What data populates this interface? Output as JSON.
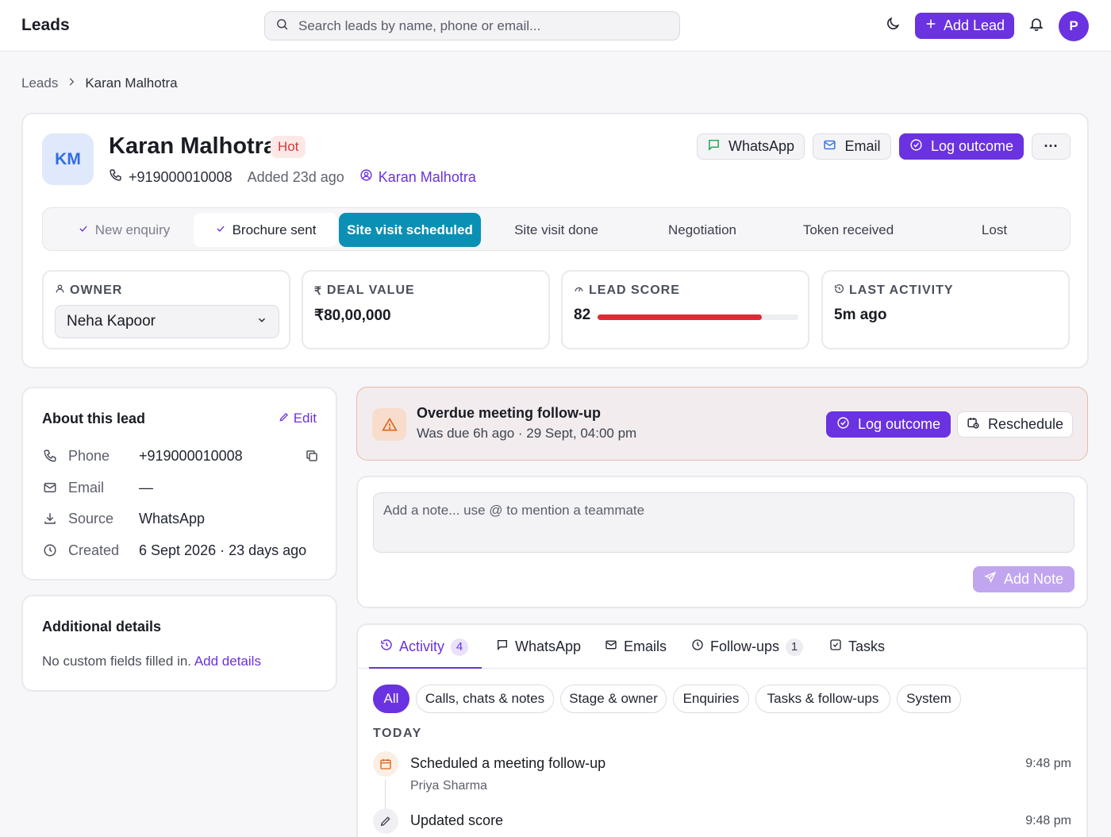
{
  "header": {
    "app_title": "Leads",
    "search_placeholder": "Search leads by name, phone or email...",
    "add_lead_label": "Add Lead",
    "user_initial": "P",
    "icons": [
      "moon-icon",
      "plus-icon",
      "bell-icon"
    ]
  },
  "breadcrumb": {
    "root": "Leads",
    "current": "Karan Malhotra"
  },
  "lead": {
    "initials": "KM",
    "name": "Karan Malhotra",
    "temperature": "Hot",
    "phone": "+919000010008",
    "added": "Added 23d ago",
    "assignee": "Karan Malhotra",
    "actions": {
      "whatsapp": "WhatsApp",
      "email": "Email",
      "log_outcome": "Log outcome",
      "more": "···"
    }
  },
  "stages": [
    {
      "label": "New enquiry",
      "state": "done"
    },
    {
      "label": "Brochure sent",
      "state": "prev"
    },
    {
      "label": "Site visit scheduled",
      "state": "current"
    },
    {
      "label": "Site visit done",
      "state": "future"
    },
    {
      "label": "Negotiation",
      "state": "future"
    },
    {
      "label": "Token received",
      "state": "future"
    },
    {
      "label": "Lost",
      "state": "future"
    }
  ],
  "stats": {
    "owner": {
      "label": "Owner",
      "value": "Neha Kapoor"
    },
    "deal_value": {
      "label": "Deal value",
      "value": "₹80,00,000"
    },
    "lead_score": {
      "label": "Lead score",
      "value": "82",
      "percent": 82,
      "bar_color": "#dc2b34"
    },
    "last_activity": {
      "label": "Last activity",
      "value": "5m ago"
    }
  },
  "about": {
    "title": "About this lead",
    "edit_label": "Edit",
    "rows": [
      {
        "label": "Phone",
        "value": "+919000010008",
        "icon": "phone-icon"
      },
      {
        "label": "Email",
        "value": "—",
        "icon": "mail-icon"
      },
      {
        "label": "Source",
        "value": "WhatsApp",
        "icon": "download-icon"
      },
      {
        "label": "Created",
        "value": "6 Sept 2026 · 23 days ago",
        "icon": "clock-icon"
      }
    ]
  },
  "additional": {
    "title": "Additional details",
    "empty_text": "No custom fields filled in.",
    "add_link": "Add details"
  },
  "overdue": {
    "title": "Overdue meeting follow-up",
    "subtitle": "Was due 6h ago · 29 Sept, 04:00 pm",
    "log_outcome": "Log outcome",
    "reschedule": "Reschedule"
  },
  "note": {
    "placeholder": "Add a note... use @ to mention a teammate",
    "add_label": "Add Note"
  },
  "activity": {
    "tabs": [
      {
        "label": "Activity",
        "count": "4"
      },
      {
        "label": "WhatsApp"
      },
      {
        "label": "Emails"
      },
      {
        "label": "Follow-ups",
        "count": "1"
      },
      {
        "label": "Tasks"
      }
    ],
    "filters": [
      "All",
      "Calls, chats & notes",
      "Stage & owner",
      "Enquiries",
      "Tasks & follow-ups",
      "System"
    ],
    "group_label": "TODAY",
    "items": [
      {
        "title": "Scheduled a meeting follow-up",
        "by": "Priya Sharma",
        "time": "9:48 pm",
        "icon": "calendar-icon"
      },
      {
        "title": "Updated score",
        "time": "9:48 pm",
        "icon": "pencil-icon"
      }
    ]
  },
  "colors": {
    "accent": "#6a32e0",
    "stage_current": "#0a90b5",
    "hot": "#d8373a",
    "overdue_bg": "#f2ecee"
  }
}
